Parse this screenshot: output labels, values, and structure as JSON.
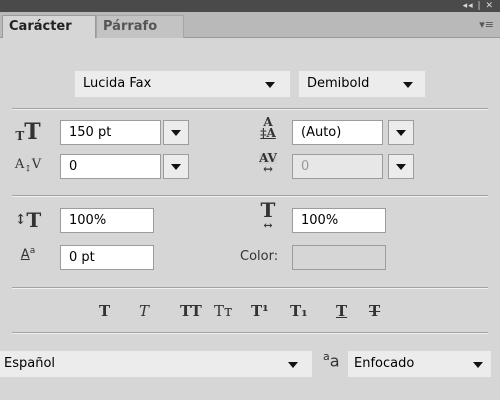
{
  "titlebar": {
    "controls": "◂◂ | ✕"
  },
  "tabs": [
    {
      "label": "Carácter",
      "active": true
    },
    {
      "label": "Párrafo",
      "active": false
    }
  ],
  "panel_menu_icon": "panel-menu-icon",
  "font": {
    "family": "Lucida Fax",
    "style": "Demibold"
  },
  "size": {
    "value": "150 pt"
  },
  "leading": {
    "value": "(Auto)"
  },
  "kerning": {
    "value": "0"
  },
  "tracking": {
    "value": "0"
  },
  "vertical_scale": {
    "value": "100%"
  },
  "horizontal_scale": {
    "value": "100%"
  },
  "baseline_shift": {
    "value": "0 pt"
  },
  "color": {
    "label": "Color:",
    "swatch": "#d6d6d6"
  },
  "style_buttons": [
    {
      "name": "faux-bold",
      "glyph": "T"
    },
    {
      "name": "faux-italic",
      "glyph": "T"
    },
    {
      "name": "all-caps",
      "glyph": "TT"
    },
    {
      "name": "small-caps",
      "glyph": "Tт"
    },
    {
      "name": "superscript",
      "glyph": "T¹"
    },
    {
      "name": "subscript",
      "glyph": "T₁"
    },
    {
      "name": "underline",
      "glyph": "T"
    },
    {
      "name": "strikethrough",
      "glyph": "T"
    }
  ],
  "language": {
    "value": "Español"
  },
  "antialias": {
    "icon_text": "aa",
    "value": "Enfocado"
  }
}
